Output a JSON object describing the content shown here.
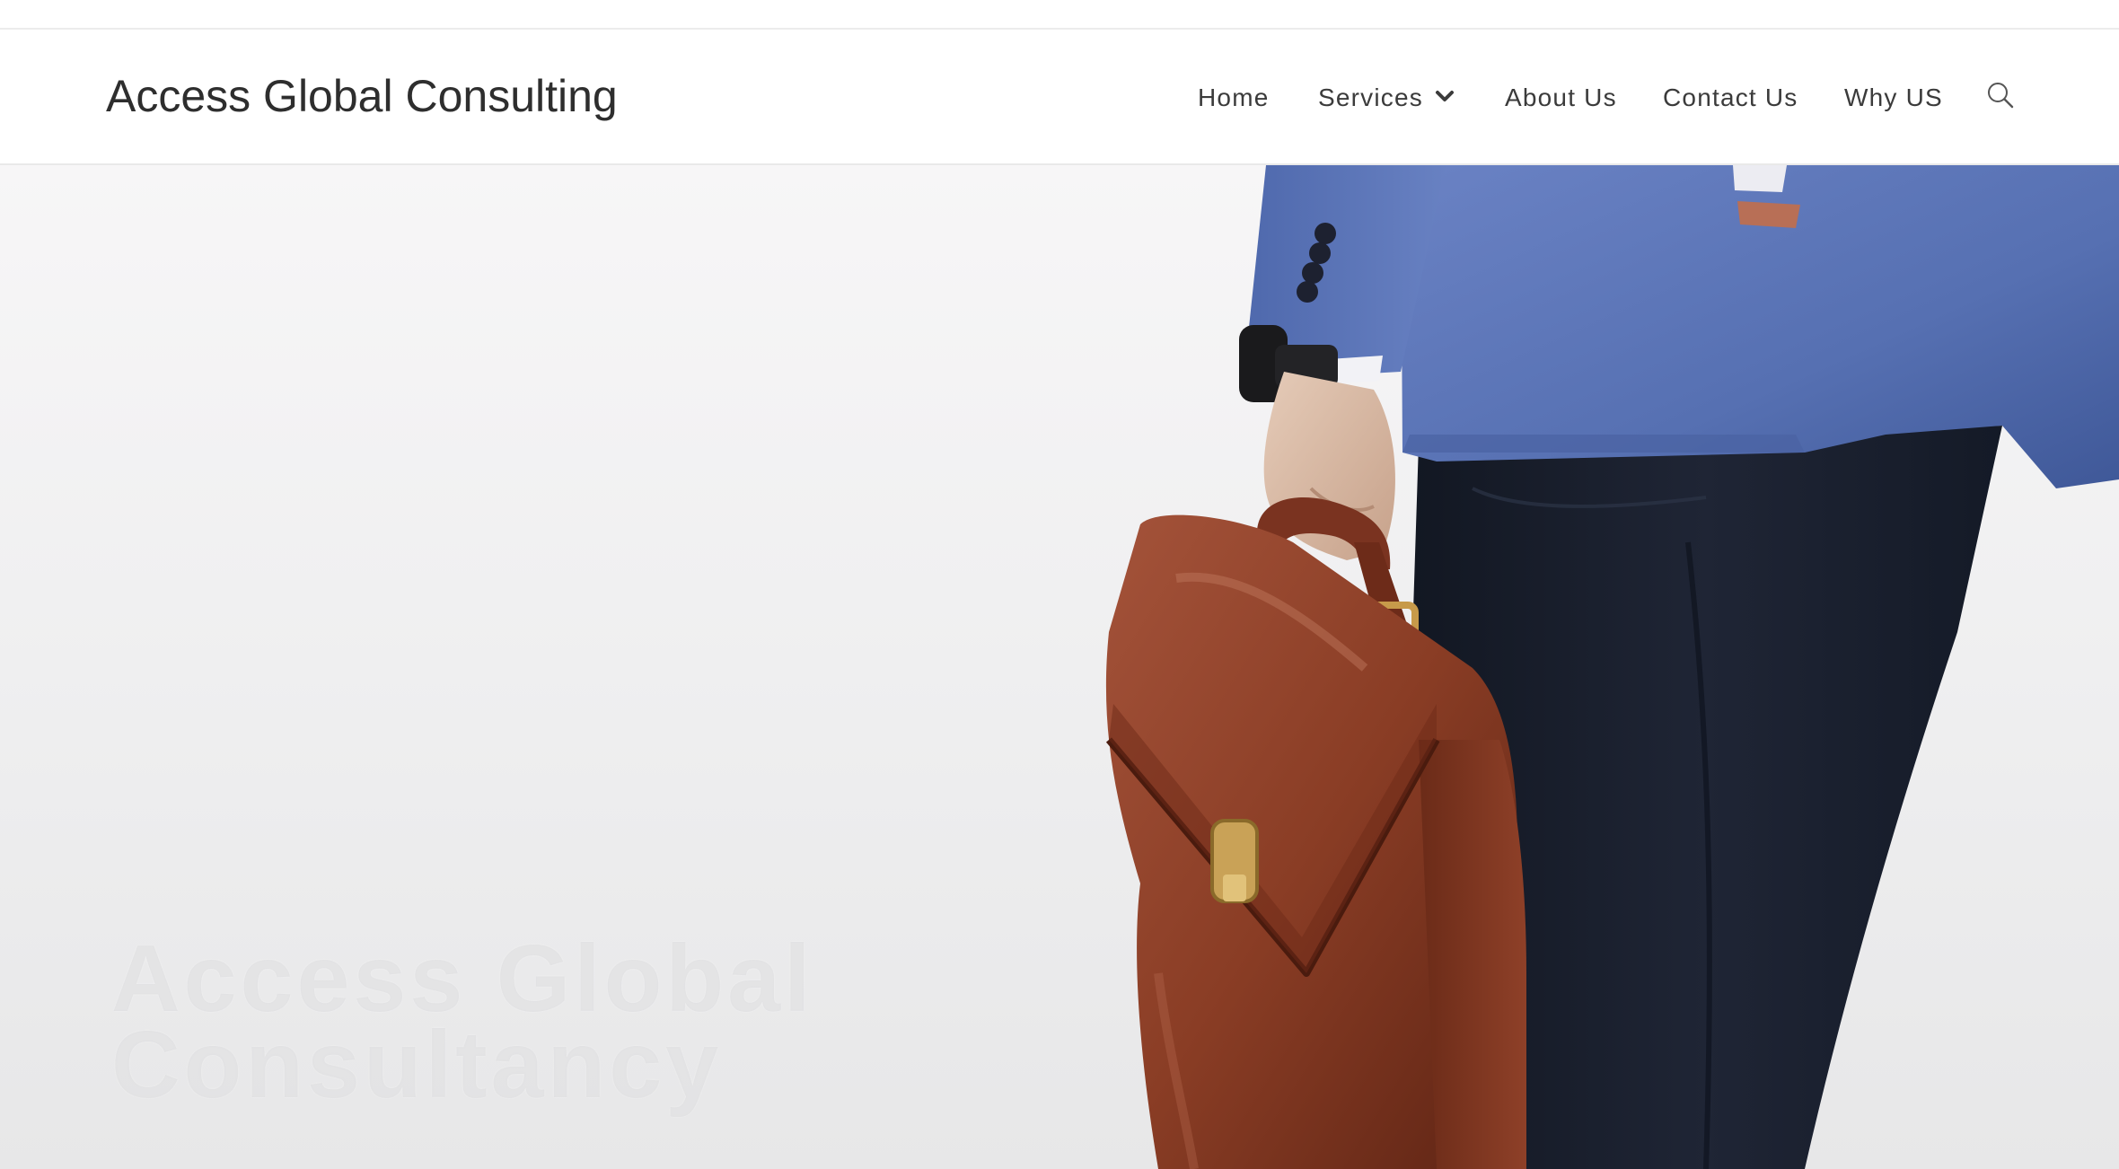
{
  "site": {
    "title": "Access Global Consulting"
  },
  "nav": {
    "items": [
      {
        "label": "Home"
      },
      {
        "label": "Services",
        "has_dropdown": true
      },
      {
        "label": "About Us"
      },
      {
        "label": "Contact Us"
      },
      {
        "label": "Why US"
      }
    ],
    "search_icon": "search-icon",
    "dropdown_icon": "chevron-down-icon"
  },
  "hero": {
    "heading_line1": "Access Global",
    "heading_line2": "Consultancy",
    "image": "businessman-with-leather-briefcase"
  },
  "colors": {
    "text_dark": "#2e2e2e",
    "nav_text": "#3b3b3b",
    "jacket_blue": "#5a72b4",
    "trousers_navy": "#1b2130",
    "briefcase_brown": "#8a3b23"
  }
}
